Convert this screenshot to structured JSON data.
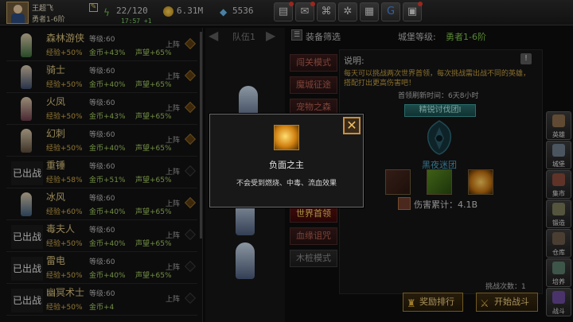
{
  "player": {
    "name": "王超飞",
    "rank": "勇者1-6阶"
  },
  "resources": {
    "stamina": "22/120",
    "timer": "17:57 +1",
    "gold": "6.31M",
    "gems": "5536"
  },
  "heroes": [
    {
      "name": "森林游侠",
      "level": "等级:60",
      "exp": "经验+50%",
      "gold": "金币+43%",
      "fame": "声望+65%",
      "status": "上阵",
      "deployed_out": false,
      "out_label": ""
    },
    {
      "name": "骑士",
      "level": "等级:60",
      "exp": "经验+50%",
      "gold": "金币+40%",
      "fame": "声望+65%",
      "status": "上阵",
      "deployed_out": false,
      "out_label": ""
    },
    {
      "name": "火凤",
      "level": "等级:60",
      "exp": "经验+50%",
      "gold": "金币+43%",
      "fame": "声望+65%",
      "status": "上阵",
      "deployed_out": false,
      "out_label": ""
    },
    {
      "name": "幻刺",
      "level": "等级:60",
      "exp": "经验+50%",
      "gold": "金币+40%",
      "fame": "声望+65%",
      "status": "上阵",
      "deployed_out": false,
      "out_label": ""
    },
    {
      "name": "重锤",
      "level": "等级:60",
      "exp": "经验+58%",
      "gold": "金币+51%",
      "fame": "声望+65%",
      "status": "上阵",
      "deployed_out": true,
      "out_label": "已出战"
    },
    {
      "name": "冰风",
      "level": "等级:60",
      "exp": "经验+60%",
      "gold": "金币+40%",
      "fame": "声望+65%",
      "status": "上阵",
      "deployed_out": false,
      "out_label": ""
    },
    {
      "name": "毒夫人",
      "level": "等级:60",
      "exp": "经验+50%",
      "gold": "金币+40%",
      "fame": "声望+65%",
      "status": "上阵",
      "deployed_out": true,
      "out_label": "已出战"
    },
    {
      "name": "雷电",
      "level": "等级:60",
      "exp": "经验+50%",
      "gold": "金币+40%",
      "fame": "声望+65%",
      "status": "上阵",
      "deployed_out": true,
      "out_label": "已出战"
    },
    {
      "name": "幽冥术士",
      "level": "等级:60",
      "exp": "经验+50%",
      "gold": "金币+4",
      "fame": "",
      "status": "上阵",
      "deployed_out": true,
      "out_label": "已出战"
    }
  ],
  "team": {
    "label": "队伍1"
  },
  "filter_label": "装备筛选",
  "modes": [
    "闯关模式",
    "魔城征途",
    "宠物之森",
    "世界首领",
    "血缘诅咒",
    "木桩模式"
  ],
  "floor": {
    "label": "城堡等级:",
    "value": "勇者1-6阶"
  },
  "boss": {
    "desc_label": "说明:",
    "desc_text": "每天可以挑战两次世界首领，每次挑战需出战不同的英雄，搭配打出更高伤害吧！",
    "refresh": "首领刷新时间：6天8小时",
    "banner": "精锐讨伐团I",
    "name": "黑夜迷团",
    "damage": "伤害累计：4.1B",
    "attempts": "挑战次数：1",
    "rank_btn": "奖励排行",
    "start_btn": "开始战斗"
  },
  "sidebar": [
    "英雄",
    "城堡",
    "集市",
    "锻造",
    "仓库",
    "培养",
    "战斗"
  ],
  "modal": {
    "title": "负面之主",
    "desc": "不会受到燃烧、中毒、流血效果"
  }
}
